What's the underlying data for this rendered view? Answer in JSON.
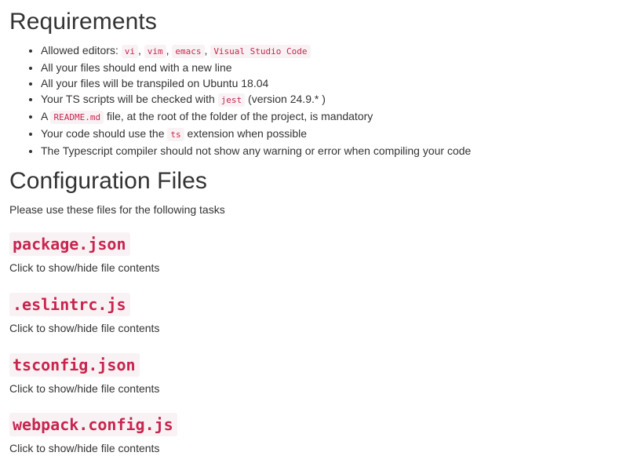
{
  "requirements": {
    "title": "Requirements",
    "items": [
      {
        "pre": "Allowed editors: ",
        "c1": "vi",
        "s1": ", ",
        "c2": "vim",
        "s2": ", ",
        "c3": "emacs",
        "s3": ", ",
        "c4": "Visual Studio Code"
      },
      {
        "text": "All your files should end with a new line"
      },
      {
        "text": "All your files will be transpiled on Ubuntu 18.04"
      },
      {
        "pre": "Your TS scripts will be checked with ",
        "code": "jest",
        "post": " (version 24.9.* )"
      },
      {
        "pre": "A ",
        "code": "README.md",
        "post": " file, at the root of the folder of the project, is mandatory"
      },
      {
        "pre": "Your code should use the ",
        "code": "ts",
        "post": " extension when possible"
      },
      {
        "text": "The Typescript compiler should not show any warning or error when compiling your code"
      }
    ]
  },
  "config": {
    "title": "Configuration Files",
    "intro": "Please use these files for the following tasks",
    "files": [
      {
        "name": "package.json",
        "toggle": "Click to show/hide file contents"
      },
      {
        "name": ".eslintrc.js",
        "toggle": "Click to show/hide file contents"
      },
      {
        "name": "tsconfig.json",
        "toggle": "Click to show/hide file contents"
      },
      {
        "name": "webpack.config.js",
        "toggle": "Click to show/hide file contents"
      }
    ]
  },
  "colors": {
    "text": "#333333",
    "code_text": "#c7254e",
    "code_bg": "#f9f2f4"
  }
}
